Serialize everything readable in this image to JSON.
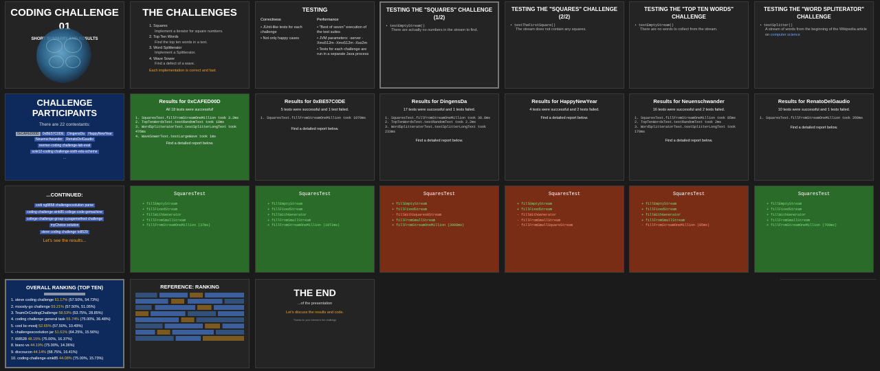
{
  "s1": {
    "title": "CODING CHALLENGE 01",
    "subtitle": "SHORT SUMMARY AND RESULTS"
  },
  "s2": {
    "title": "THE CHALLENGES",
    "items": [
      {
        "label": "1. Squares",
        "sub": "Implement a iterator for square numbers."
      },
      {
        "label": "2. Top Ten Words",
        "sub": "Find the top ten words in a text."
      },
      {
        "label": "3. Word Splitterator",
        "sub": "Implement a Splitterator."
      },
      {
        "label": "4. Wave Sower",
        "sub": "Find a defect of a wave."
      }
    ],
    "note": "Each implementation is correct and fast."
  },
  "s3": {
    "title": "TESTING",
    "col1_head": "Correctness",
    "col1": [
      "JUnit-like tests for each challenge",
      "Not only happy cases"
    ],
    "col2_head": "Performance",
    "col2": [
      "\"Best of seven\" execution of the test suites",
      "JVM parameters: -server -Xms512m -Xmx512m -Xss2m",
      "Tests for each challenge are run in a separate Java process"
    ]
  },
  "s4": {
    "title": "TESTING THE \"SQUARES\" CHALLENGE (1/2)",
    "code": "• testEmptyStream()",
    "text": "There are actually no numbers in the stream to find."
  },
  "s5": {
    "title": "TESTING THE \"SQUARES\" CHALLENGE (2/2)",
    "code": "• testTheFirstSquare()",
    "text": "The stream does not contain any squares."
  },
  "s6": {
    "title": "TESTING THE \"TOP TEN WORDS\" CHALLENGE",
    "code": "• testEmptyStream()",
    "text": "There are no words to collect from the stream."
  },
  "s7": {
    "title": "TESTING THE \"WORD SPLITERATOR\" CHALLENGE",
    "code": "• testSplitter()",
    "text": "A stream of words from the beginning of the Wikipedia article on",
    "link": "computer science"
  },
  "p1": {
    "title": "CHALLENGE PARTICIPANTS",
    "intro": "There are 22 contestants:",
    "names": [
      "0xCAFED00D",
      "0xBE57C0DE",
      "DingensDa",
      "HappyNewYear",
      "Neuenschwander",
      "RenatoDelGaudio",
      "reemer-coding challenge-lab-eval",
      "sole12-coding challenge-sixth-edu-scheme"
    ],
    "more": "..."
  },
  "r1": {
    "title": "Results for 0xCAFED00D",
    "summary": "All 18 tests were successful!",
    "lines": [
      "1. SquaresTest.fillFromStreamOneMillion took 3.2ms",
      "2. TopTenWordsTest.testRandomText took 18ms",
      "3. WordSplitteratorTest.testSplitterLongText took 476ms",
      "4. WaveSowerTest.testLargeWave took 1ms"
    ],
    "footer": "Find a detailed report below."
  },
  "r2": {
    "title": "Results for 0xBE57C0DE",
    "summary": "5 tests were successful and 1 test failed.",
    "lines": [
      "1. SquaresTest.fillFromStreamOneMillion took 1070ms"
    ],
    "footer": "Find a detailed report below."
  },
  "r3": {
    "title": "Results for DingensDa",
    "summary": "17 tests were successful and 1 tests failed.",
    "lines": [
      "1. SquaresTest.fillFromStreamOneMillion took 38.8ms",
      "2. TopTenWordsTest.testRandomText took 2.2ms",
      "3. WordSplitteratorTest.testSplitterLongText took 233ms"
    ],
    "footer": "Find a detailed report below."
  },
  "r4": {
    "title": "Results for HappyNewYear",
    "summary": "4 tests were successful and 2 tests failed.",
    "lines": [],
    "footer": "Find a detailed report below."
  },
  "r5": {
    "title": "Results for Neuenschwander",
    "summary": "16 tests were successful and 2 tests failed.",
    "lines": [
      "1. SquaresTest.fillFromStreamOneMillion took 85ms",
      "2. TopTenWordsTest.testRandomText took 2ms",
      "3. WordSplitteratorTest.testSplitterLongText took 170ms"
    ],
    "footer": "Find a detailed report below."
  },
  "r6": {
    "title": "Results for RenatoDelGaudio",
    "summary": "10 tests were successful and 1 tests failed.",
    "lines": [
      "1. SquaresTest.fillFromStreamOneMillion took 260ms"
    ],
    "footer": "Find a detailed report below."
  },
  "c1": {
    "title": "...CONTINUED:",
    "names": [
      "codi ng8858 challengecoolution parse",
      "coding-challenge-sink85 college-code-gemachine",
      "college-challenge-group-q-pagemethod-challenge",
      "myChoice solution",
      "steve coding challenge to8529"
    ],
    "cta": "Let's see the results..."
  },
  "suites": [
    {
      "title": "SquaresTest",
      "color": "green",
      "items": [
        [
          "+",
          "fillEmptyStream"
        ],
        [
          "+",
          "fillFixedStream"
        ],
        [
          "+",
          "fillWithGenerator"
        ],
        [
          "+",
          "fillFromSmallStream"
        ],
        [
          "+",
          "fillFromStreamOneMillion  (37ms)"
        ]
      ]
    },
    {
      "title": "SquaresTest",
      "color": "green",
      "items": [
        [
          "+",
          "fillEmptyStream"
        ],
        [
          "+",
          "fillFixedStream"
        ],
        [
          "+",
          "fillWithGenerator"
        ],
        [
          "+",
          "fillFromSmallStream"
        ],
        [
          "+",
          "fillFromStreamOneMillion  (1071ms)"
        ]
      ]
    },
    {
      "title": "SquaresTest",
      "color": "red",
      "items": [
        [
          "+",
          "fillEmptyStream"
        ],
        [
          "+",
          "fillFixedStream"
        ],
        [
          "-",
          "fillWithSquares0Stream"
        ],
        [
          "+",
          "fillFromSmallStream"
        ],
        [
          "+",
          "fillFromStreamOneMillion  (3988ms)"
        ]
      ]
    },
    {
      "title": "SquaresTest",
      "color": "red",
      "items": [
        [
          "+",
          "fillEmptyStream"
        ],
        [
          "+",
          "fillFixedStream"
        ],
        [
          "-",
          "fillWithGenerator"
        ],
        [
          "-",
          "fillFromSmallStream"
        ],
        [
          "-",
          "fillFromSmallSquareStream"
        ]
      ]
    },
    {
      "title": "SquaresTest",
      "color": "red",
      "items": [
        [
          "+",
          "fillEmptyStream"
        ],
        [
          "+",
          "fillFixedStream"
        ],
        [
          "+",
          "fillWithGenerator"
        ],
        [
          "+",
          "fillFromSmallStream"
        ],
        [
          "-",
          "fillFromStreamOneMillion  (85ms)"
        ]
      ]
    },
    {
      "title": "SquaresTest",
      "color": "green",
      "items": [
        [
          "+",
          "fillEmptyStream"
        ],
        [
          "+",
          "fillFixedStream"
        ],
        [
          "+",
          "fillWithGenerator"
        ],
        [
          "+",
          "fillFromSmallStream"
        ],
        [
          "+",
          "fillFromStreamOneMillion  (760ms)"
        ]
      ]
    }
  ],
  "rank": {
    "title": "OVERALL RANKING (TOP TEN)",
    "badge": "",
    "items": [
      {
        "name": "1. steve coding challenge",
        "pct": "61.17%",
        "rest": "(57.50%, 54.73%)"
      },
      {
        "name": "2. moosty-go challenge",
        "pct": "59.21%",
        "rest": "(57.50%, 51.05%)"
      },
      {
        "name": "3. TeamOrCodingChallenge",
        "pct": "58.53%",
        "rest": "(53.75%, 28.85%)"
      },
      {
        "name": "4. coding challenge general task",
        "pct": "55.74%",
        "rest": "(75.00%, 36.48%)"
      },
      {
        "name": "5. cool bc-moolj",
        "pct": "52.65%",
        "rest": "(57.50%, 10.49%)"
      },
      {
        "name": "6. challengescoolution jar",
        "pct": "51.61%",
        "rest": "(64.25%, 15.56%)"
      },
      {
        "name": "7. t58528",
        "pct": "48.15%",
        "rest": "(75.00%, 16.37%)"
      },
      {
        "name": "8. bianc-vs",
        "pct": "44.19%",
        "rest": "(75.00%, 14.36%)"
      },
      {
        "name": "9. divcoucon",
        "pct": "44.14%",
        "rest": "(58.75%, 16.41%)"
      },
      {
        "name": "10. coding-challenge-sink85",
        "pct": "44.08%",
        "rest": "(75.00%, 15.73%)"
      }
    ]
  },
  "ref": {
    "title": "REFERENCE: RANKING"
  },
  "end": {
    "title": "THE END",
    "sub": "...of the presentation",
    "cta": "Let's discuss the results and code.",
    "tiny": "Thanks for your interest in the challenge"
  }
}
